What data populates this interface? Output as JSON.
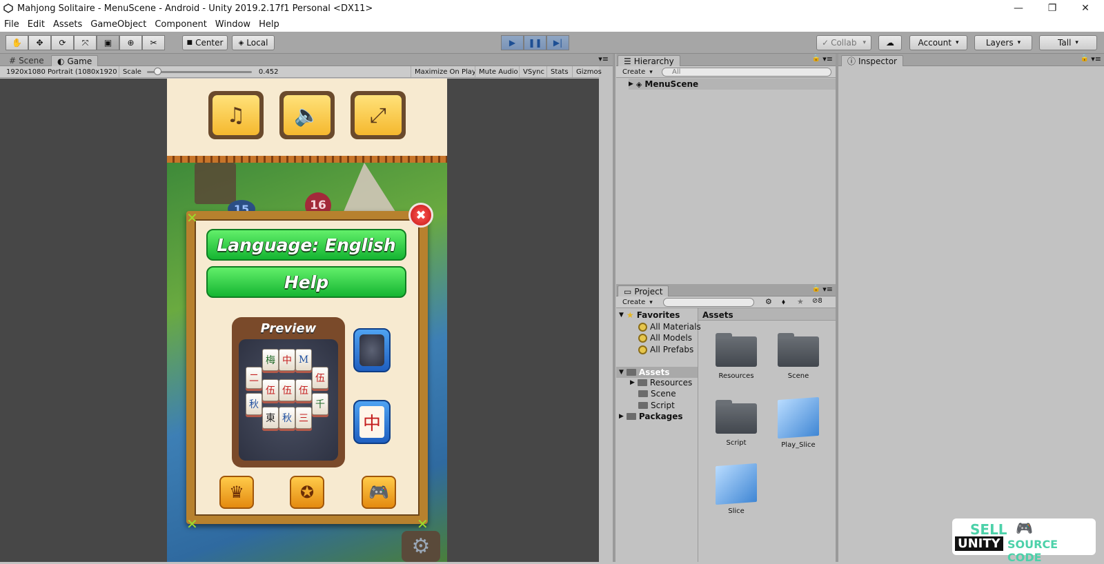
{
  "window": {
    "title": "Mahjong Solitaire - MenuScene - Android - Unity 2019.2.17f1 Personal <DX11>",
    "controls": {
      "minimize": "—",
      "restore": "❐",
      "close": "✕"
    }
  },
  "menu": [
    "File",
    "Edit",
    "Assets",
    "GameObject",
    "Component",
    "Window",
    "Help"
  ],
  "toolbar": {
    "tools": [
      "hand-icon",
      "move-icon",
      "rotate-icon",
      "scale-icon",
      "rect-icon",
      "transform-icon",
      "custom-tool-icon"
    ],
    "pivot": "Center",
    "space": "Local",
    "collab": "Collab",
    "account": "Account",
    "layers": "Layers",
    "layout": "Tall"
  },
  "tabs": {
    "scene": "Scene",
    "game": "Game",
    "hierarchy": "Hierarchy",
    "inspector": "Inspector",
    "project": "Project"
  },
  "gamebar": {
    "resolution": "1920x1080 Portrait (1080x1920)",
    "scale_label": "Scale",
    "scale_value": "0.452",
    "scale_fraction": 0.1,
    "maximize": "Maximize On Play",
    "mute": "Mute Audio",
    "vsync": "VSync",
    "stats": "Stats",
    "gizmos": "Gizmos"
  },
  "game": {
    "level_a": "15",
    "level_b": "16",
    "language_button": "Language: English",
    "help_button": "Help",
    "preview_label": "Preview",
    "tiles": [
      "梅",
      "中",
      "M",
      "伍",
      "二",
      "伍",
      "伍",
      "伍",
      "秋",
      "東",
      "秋",
      "三",
      "千"
    ]
  },
  "hierarchy": {
    "create": "Create",
    "search_placeholder": "All",
    "scene": "MenuScene"
  },
  "project": {
    "create": "Create",
    "count": "8",
    "favorites": "Favorites",
    "favorite_items": [
      "All Materials",
      "All Models",
      "All Prefabs"
    ],
    "assets_root": "Assets",
    "asset_folders": [
      "Resources",
      "Scene",
      "Script"
    ],
    "packages": "Packages",
    "breadcrumb": "Assets",
    "grid": [
      "Resources",
      "Scene",
      "Script",
      "Play_Slice",
      "Slice"
    ]
  },
  "badge": {
    "sell": "SELL",
    "unity": "UNITY",
    "source": "SOURCE CODE"
  }
}
